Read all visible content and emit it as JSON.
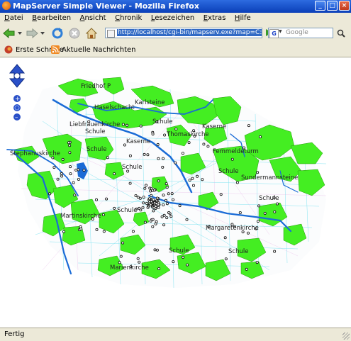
{
  "window": {
    "title": "MapServer Simple Viewer - Mozilla Firefox"
  },
  "menu": [
    "Datei",
    "Bearbeiten",
    "Ansicht",
    "Chronik",
    "Lesezeichen",
    "Extras",
    "Hilfe"
  ],
  "nav": {
    "url": "http://localhost/cgi-bin/mapserv.exe?map=C:/inte",
    "search_placeholder": "Google",
    "search_engine_glyph": "G"
  },
  "bookmarks": [
    {
      "label": "Erste Schritte",
      "icon": "firefox-icon"
    },
    {
      "label": "Aktuelle Nachrichten",
      "icon": "rss-feed-icon"
    }
  ],
  "map": {
    "labels": [
      "Friedhof P",
      "Haselschacht",
      "Karlsteine",
      "Liebfrauenkirche",
      "Schule",
      "Schule",
      "Thomaskirche",
      "Kaserne",
      "Kaserne",
      "Femmeldeturm",
      "Stephanuskirche",
      "Schule",
      "Schule",
      "Sundermannsteine",
      "Schule",
      "Schule",
      "Martinskirche",
      "Margaretenkirche",
      "Schule",
      "Schule",
      "Marienkirche",
      "Schule"
    ],
    "colors": {
      "park": "#44ee22",
      "river": "#1a6bd6",
      "street": "#66ddee",
      "marker": "#111111"
    }
  },
  "status": {
    "text": "Fertig"
  }
}
